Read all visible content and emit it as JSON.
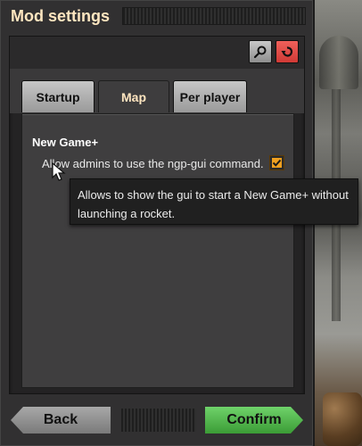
{
  "window": {
    "title": "Mod settings"
  },
  "toolbar": {
    "search_icon": "search-icon",
    "reset_icon": "reset-icon"
  },
  "tabs": [
    {
      "label": "Startup",
      "active": false
    },
    {
      "label": "Map",
      "active": true
    },
    {
      "label": "Per player",
      "active": false
    }
  ],
  "content": {
    "section_title": "New Game+",
    "setting": {
      "label": "Allow admins to use the ngp-gui command.",
      "checked": true
    }
  },
  "tooltip": {
    "line1": "Allows to show the gui to start a New Game+ without",
    "line2": "launching a rocket."
  },
  "buttons": {
    "back": "Back",
    "confirm": "Confirm"
  },
  "colors": {
    "title": "#ffe6c0",
    "confirm": "#5ec25a",
    "reset": "#e04c47",
    "checkbox": "#f0a020"
  }
}
